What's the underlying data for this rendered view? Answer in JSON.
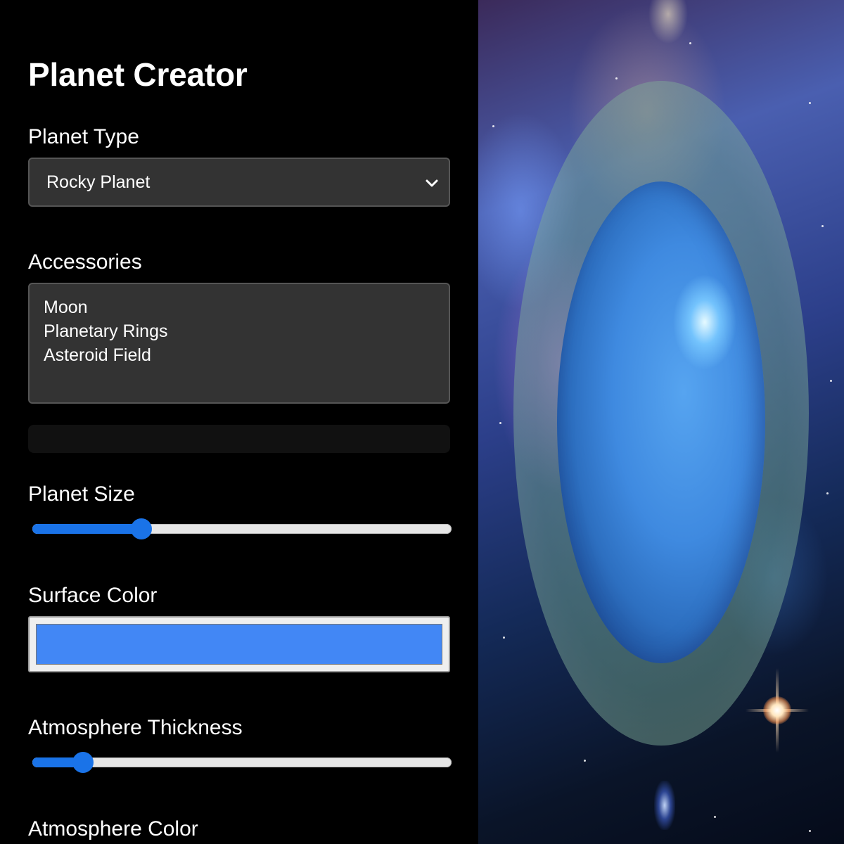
{
  "panel": {
    "title": "Planet Creator",
    "planet_type": {
      "label": "Planet Type",
      "selected": "Rocky Planet"
    },
    "accessories": {
      "label": "Accessories",
      "options": [
        "Moon",
        "Planetary Rings",
        "Asteroid Field"
      ]
    },
    "progress": {
      "value": 0
    },
    "planet_size": {
      "label": "Planet Size",
      "value_fraction": 0.26
    },
    "surface_color": {
      "label": "Surface Color",
      "value": "#4287f5"
    },
    "atmosphere_thickness": {
      "label": "Atmosphere Thickness",
      "value_fraction": 0.12
    },
    "atmosphere_color": {
      "label": "Atmosphere Color"
    }
  },
  "colors": {
    "panel_bg": "#000000",
    "control_bg": "#333333",
    "accent": "#1a73e8",
    "surface": "#4287f5"
  },
  "icons": {
    "select_chevron": "chevron-down-icon"
  }
}
